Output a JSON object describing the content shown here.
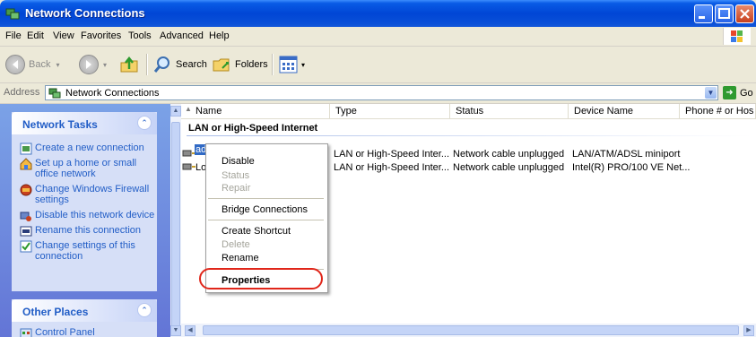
{
  "window": {
    "title": "Network Connections"
  },
  "menubar": {
    "items": [
      "File",
      "Edit",
      "View",
      "Favorites",
      "Tools",
      "Advanced",
      "Help"
    ]
  },
  "toolbar": {
    "back": "Back",
    "search": "Search",
    "folders": "Folders"
  },
  "address": {
    "label": "Address",
    "value": "Network Connections",
    "go": "Go"
  },
  "network_tasks": {
    "title": "Network Tasks",
    "items": [
      {
        "label": "Create a new connection",
        "icon": "new-connection-icon"
      },
      {
        "label": "Set up a home or small office network",
        "icon": "home-network-icon"
      },
      {
        "label": "Change Windows Firewall settings",
        "icon": "firewall-icon"
      },
      {
        "label": "Disable this network device",
        "icon": "disable-device-icon"
      },
      {
        "label": "Rename this connection",
        "icon": "rename-icon"
      },
      {
        "label": "Change settings of this connection",
        "icon": "settings-icon"
      }
    ]
  },
  "other_places": {
    "title": "Other Places",
    "items": [
      {
        "label": "Control Panel",
        "icon": "control-panel-icon"
      }
    ]
  },
  "columns": [
    "Name",
    "Type",
    "Status",
    "Device Name",
    "Phone # or Hos"
  ],
  "group": {
    "title": "LAN or High-Speed Internet"
  },
  "rows": [
    {
      "name": "ad",
      "type": "LAN or High-Speed Inter...",
      "status": "Network cable unplugged",
      "device": "LAN/ATM/ADSL miniport"
    },
    {
      "name": "Lo",
      "type": "LAN or High-Speed Inter...",
      "status": "Network cable unplugged",
      "device": "Intel(R) PRO/100 VE Net..."
    }
  ],
  "context_menu": {
    "disable": "Disable",
    "status": "Status",
    "repair": "Repair",
    "bridge": "Bridge Connections",
    "shortcut": "Create Shortcut",
    "delete": "Delete",
    "rename": "Rename",
    "properties": "Properties"
  },
  "colors": {
    "title_bar": "#0046d5",
    "task_link": "#215dc6",
    "highlight": "#e0261a"
  }
}
